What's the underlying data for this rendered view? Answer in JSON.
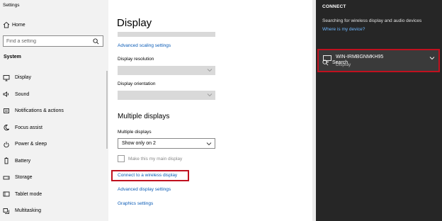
{
  "sidebar": {
    "window_title": "Settings",
    "home_label": "Home",
    "search_placeholder": "Find a setting",
    "section_label": "System",
    "items": [
      {
        "label": "Display",
        "icon": "monitor-icon"
      },
      {
        "label": "Sound",
        "icon": "speaker-icon"
      },
      {
        "label": "Notifications & actions",
        "icon": "notification-icon"
      },
      {
        "label": "Focus assist",
        "icon": "moon-icon"
      },
      {
        "label": "Power & sleep",
        "icon": "power-icon"
      },
      {
        "label": "Battery",
        "icon": "battery-icon"
      },
      {
        "label": "Storage",
        "icon": "storage-icon"
      },
      {
        "label": "Tablet mode",
        "icon": "tablet-icon"
      },
      {
        "label": "Multitasking",
        "icon": "multitasking-icon"
      }
    ]
  },
  "main": {
    "title": "Display",
    "advanced_scaling_link": "Advanced scaling settings",
    "resolution_label": "Display resolution",
    "orientation_label": "Display orientation",
    "multiple_heading": "Multiple displays",
    "multiple_label": "Multiple displays",
    "multiple_value": "Show only on 2",
    "make_main_label": "Make this my main display",
    "connect_wireless_link": "Connect to a wireless display",
    "advanced_display_link": "Advanced display settings",
    "graphics_link": "Graphics settings"
  },
  "connect": {
    "title": "CONNECT",
    "searching_text": "Searching for wireless display and audio devices",
    "where_link": "Where is my device?",
    "search_label": "Search",
    "device_name": "WIN-IRMBGNMKH95",
    "device_type": "Display"
  },
  "colors": {
    "highlight": "#c0111f",
    "link": "#0a5bb6",
    "panel_bg": "#262626"
  }
}
